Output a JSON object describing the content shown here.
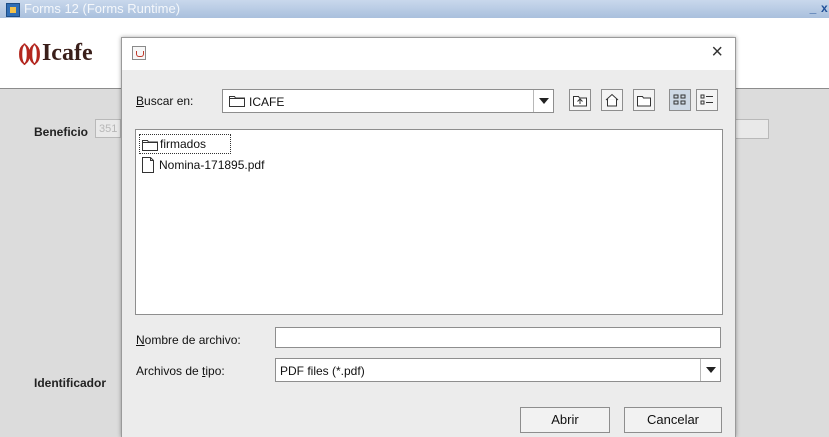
{
  "window": {
    "title": "Forms 12 (Forms Runtime)",
    "minimize_glyph": "_",
    "close_glyph": "x"
  },
  "app": {
    "logo_mark": "()()",
    "logo_text": "Icafe",
    "beneficio_label": "Beneficio",
    "beneficio_value": "351",
    "identificador_label": "Identificador"
  },
  "dialog": {
    "title_icon": "java-cup-icon",
    "close_glyph": "×",
    "look_in": {
      "label_mnemonic": "B",
      "label_rest": "uscar en:",
      "value": "ICAFE"
    },
    "toolbar": [
      {
        "name": "up-folder-icon"
      },
      {
        "name": "home-icon"
      },
      {
        "name": "new-folder-icon"
      },
      {
        "name": "list-view-icon"
      },
      {
        "name": "details-view-icon"
      }
    ],
    "files": [
      {
        "name": "firmados",
        "type": "folder",
        "selected": true
      },
      {
        "name": "Nomina-171895.pdf",
        "type": "file",
        "selected": false
      }
    ],
    "file_name": {
      "label_mnemonic": "N",
      "label_rest": "ombre de archivo:",
      "value": ""
    },
    "file_type": {
      "label_pre": "Archivos de ",
      "label_mnemonic": "t",
      "label_post": "ipo:",
      "value": "PDF files (*.pdf)"
    },
    "open_button": "Abrir",
    "cancel_button": "Cancelar"
  },
  "colors": {
    "titlebar": "#a9c0dd",
    "background": "#dcdcdc",
    "dialog": "#ececec",
    "logo_mark": "#b3261e"
  }
}
